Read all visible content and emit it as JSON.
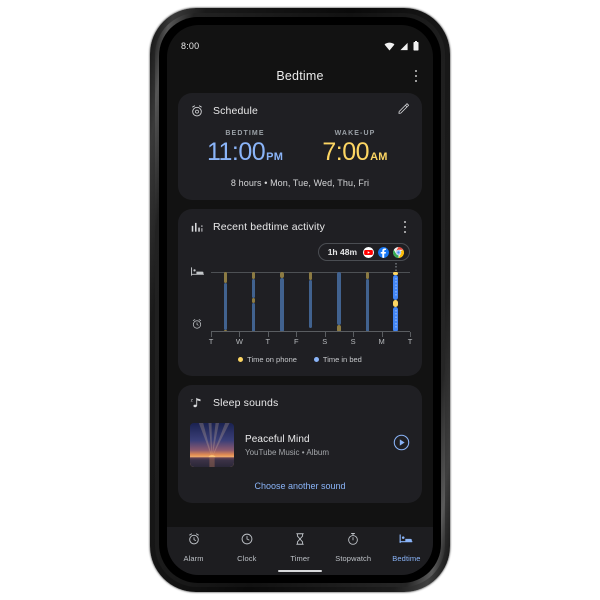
{
  "status_bar": {
    "time": "8:00",
    "icons": [
      "wifi-icon",
      "signal-icon",
      "battery-icon"
    ]
  },
  "app_bar": {
    "title": "Bedtime",
    "overflow_icon": "more-vert-icon"
  },
  "schedule_card": {
    "icon": "alarm-schedule-icon",
    "title": "Schedule",
    "edit_icon": "pencil-edit-icon",
    "bedtime": {
      "label": "BEDTIME",
      "time": "11:00",
      "meridiem": "PM",
      "color": "#8ab4f8"
    },
    "wakeup": {
      "label": "WAKE-UP",
      "time": "7:00",
      "meridiem": "AM",
      "color": "#fdd663"
    },
    "summary": "8 hours • Mon, Tue, Wed, Thu, Fri"
  },
  "activity_card": {
    "icon": "bar-chart-icon",
    "title": "Recent bedtime activity",
    "overflow_icon": "more-vert-icon",
    "usage_chip": {
      "duration": "1h 48m",
      "apps": [
        {
          "name": "youtube-icon",
          "color": "#ff0000"
        },
        {
          "name": "facebook-icon",
          "color": "#1877f2"
        },
        {
          "name": "chrome-icon",
          "color": "#4285f4"
        }
      ]
    },
    "gutter_icons": [
      "bed-icon",
      "alarm-clock-icon"
    ],
    "legend": [
      {
        "label": "Time on phone",
        "color": "#fdd663"
      },
      {
        "label": "Time in bed",
        "color": "#8ab4f8"
      }
    ],
    "chart_data": {
      "type": "bar",
      "title": "Recent bedtime activity",
      "xlabel": "",
      "ylabel": "",
      "categories": [
        "T",
        "W",
        "T",
        "F",
        "S",
        "S",
        "M",
        "T"
      ],
      "bar_days": [
        "T",
        "W",
        "T",
        "F",
        "S",
        "S",
        "M"
      ],
      "selected_index": 6,
      "selected_label": "M",
      "legend": [
        "Time on phone",
        "Time in bed"
      ],
      "series": [
        {
          "name": "Time in bed",
          "color": "#41628f",
          "selected_color": "#4285f4",
          "note": "fraction of plot height, 0 = bedtime line at top, 1 = wake line at bottom",
          "spans": [
            [
              {
                "start": 0.19,
                "end": 0.96
              }
            ],
            [
              {
                "start": 0.11,
                "end": 0.44
              },
              {
                "start": 0.52,
                "end": 1.0
              }
            ],
            [
              {
                "start": 0.1,
                "end": 1.0
              }
            ],
            [
              {
                "start": 0.13,
                "end": 0.93
              }
            ],
            [
              {
                "start": 0.0,
                "end": 0.88
              }
            ],
            [
              {
                "start": 0.12,
                "end": 1.0
              }
            ],
            [
              {
                "start": 0.05,
                "end": 0.46
              },
              {
                "start": 0.58,
                "end": 1.0
              }
            ]
          ]
        },
        {
          "name": "Time on phone",
          "color": "#8c7b43",
          "selected_color": "#fdd663",
          "spans": [
            [
              {
                "start": 0.0,
                "end": 0.19
              },
              {
                "start": 0.96,
                "end": 1.0
              }
            ],
            [
              {
                "start": 0.0,
                "end": 0.11
              },
              {
                "start": 0.44,
                "end": 0.52
              }
            ],
            [
              {
                "start": 0.0,
                "end": 0.1
              }
            ],
            [
              {
                "start": 0.0,
                "end": 0.13
              }
            ],
            [
              {
                "start": 0.88,
                "end": 1.0
              }
            ],
            [
              {
                "start": 0.0,
                "end": 0.12
              }
            ],
            [
              {
                "start": 0.0,
                "end": 0.05
              },
              {
                "start": 0.46,
                "end": 0.58
              }
            ]
          ]
        }
      ]
    }
  },
  "sleep_sounds_card": {
    "icon": "music-note-icon",
    "title": "Sleep  sounds",
    "track": {
      "title": "Peaceful Mind",
      "subtitle": "YouTube Music • Album",
      "artwork": "sunset-over-water-thumbnail",
      "play_icon": "play-circle-icon"
    },
    "choose_link": "Choose another sound"
  },
  "bottom_nav": {
    "items": [
      {
        "label": "Alarm",
        "icon": "alarm-icon",
        "active": false,
        "underline": false
      },
      {
        "label": "Clock",
        "icon": "clock-icon",
        "active": false,
        "underline": false
      },
      {
        "label": "Timer",
        "icon": "hourglass-icon",
        "active": false,
        "underline": true
      },
      {
        "label": "Stopwatch",
        "icon": "stopwatch-icon",
        "active": false,
        "underline": false
      },
      {
        "label": "Bedtime",
        "icon": "bed-icon",
        "active": true,
        "underline": false
      }
    ],
    "active_color": "#8ab4f8"
  }
}
